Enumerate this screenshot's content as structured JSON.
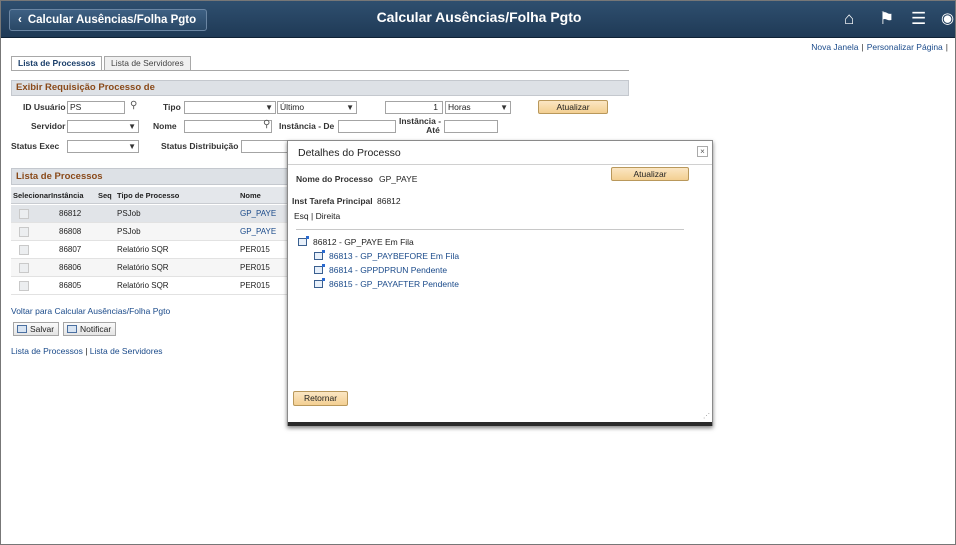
{
  "header": {
    "back_label": "Calcular Ausências/Folha Pgto",
    "title": "Calcular Ausências/Folha Pgto",
    "icons": [
      "home-icon",
      "flag-icon",
      "menu-icon",
      "navbar-icon"
    ]
  },
  "top_links": {
    "new_window": "Nova Janela",
    "personalize": "Personalizar Página"
  },
  "tabs": [
    "Lista de Processos",
    "Lista de Servidores"
  ],
  "request": {
    "section_title": "Exibir Requisição Processo de",
    "user_id_label": "ID Usuário",
    "user_id_value": "PS",
    "type_label": "Tipo",
    "type_value": "",
    "last_value": "Último",
    "count_value": "1",
    "unit_value": "Horas",
    "refresh_label": "Atualizar",
    "server_label": "Servidor",
    "server_value": "",
    "name_label": "Nome",
    "name_value": "",
    "instance_from_label": "Instância - De",
    "instance_to_label_1": "Instância -",
    "instance_to_label_2": "Até",
    "run_status_label": "Status Exec",
    "run_status_value": "",
    "dist_status_label": "Status Distribuição"
  },
  "process_list": {
    "section_title": "Lista de Processos",
    "columns": [
      "Selecionar",
      "Instância",
      "Seq",
      "Tipo de Processo",
      "Nome"
    ],
    "rows": [
      {
        "instance": "86812",
        "seq": "",
        "type": "PSJob",
        "name": "GP_PAYE",
        "link": true
      },
      {
        "instance": "86808",
        "seq": "",
        "type": "PSJob",
        "name": "GP_PAYE",
        "link": true
      },
      {
        "instance": "86807",
        "seq": "",
        "type": "Relatório SQR",
        "name": "PER015",
        "link": false
      },
      {
        "instance": "86806",
        "seq": "",
        "type": "Relatório SQR",
        "name": "PER015",
        "link": false
      },
      {
        "instance": "86805",
        "seq": "",
        "type": "Relatório SQR",
        "name": "PER015",
        "link": false
      }
    ]
  },
  "footer": {
    "return_link": "Voltar para Calcular Ausências/Folha Pgto",
    "save_label": "Salvar",
    "notify_label": "Notificar",
    "bottom_link_1": "Lista de Processos",
    "bottom_link_sep": "|",
    "bottom_link_2": "Lista de Servidores"
  },
  "modal": {
    "title": "Detalhes do Processo",
    "refresh_label": "Atualizar",
    "process_name_label": "Nome do Processo",
    "process_name_value": "GP_PAYE",
    "main_task_label": "Inst Tarefa Principal",
    "main_task_value": "86812",
    "left_link": "Esq",
    "link_sep": "|",
    "right_link": "Direita",
    "tree_root": "86812 - GP_PAYE Em Fila",
    "tree_children": [
      "86813 - GP_PAYBEFORE Em Fila",
      "86814 - GPPDPRUN Pendente",
      "86815 - GP_PAYAFTER Pendente"
    ],
    "return_label": "Retornar"
  },
  "colors": {
    "header_bg": "#2a4866",
    "section_title": "#8a4a1a",
    "link": "#1a4a8a",
    "button_bg": "#f3cf92"
  }
}
